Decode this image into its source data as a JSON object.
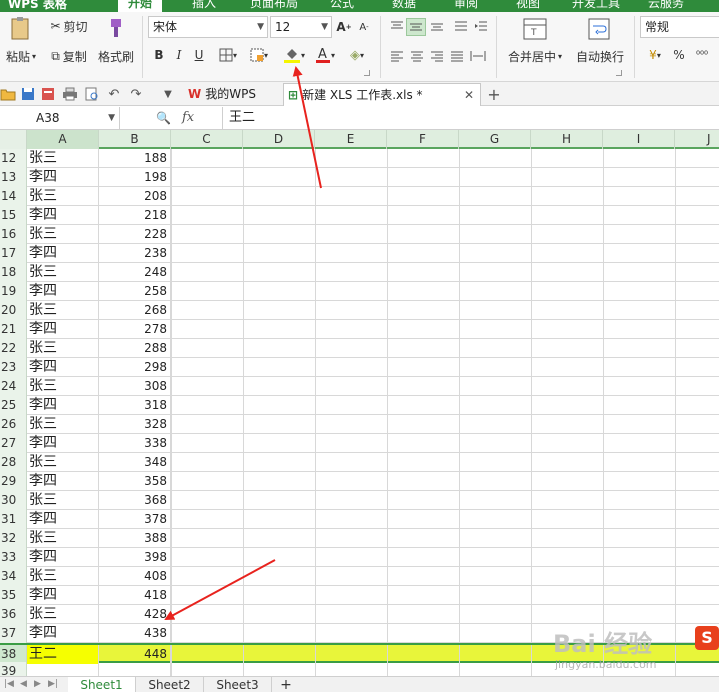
{
  "menu": {
    "app_name": "WPS 表格",
    "tabs": [
      "开始",
      "插入",
      "页面布局",
      "公式",
      "数据",
      "审阅",
      "视图",
      "开发工具",
      "云服务"
    ],
    "active_tab": "开始"
  },
  "ribbon": {
    "paste_label": "粘贴",
    "cut_label": "剪切",
    "copy_label": "复制",
    "format_painter_label": "格式刷",
    "font_name": "宋体",
    "font_size": "12",
    "bold": "B",
    "italic": "I",
    "underline": "U",
    "merge_center_label": "合并居中",
    "wrap_text_label": "自动换行",
    "number_format": "常规",
    "percent": "%",
    "fill_color": "#f5f500",
    "font_color": "#e02020"
  },
  "doc_tabs": {
    "home_tab": "我的WPS",
    "file_tab": "新建 XLS 工作表.xls *"
  },
  "formula_bar": {
    "cell_ref": "A38",
    "fx": "fx",
    "value": "王二"
  },
  "grid": {
    "columns": [
      "A",
      "B",
      "C",
      "D",
      "E",
      "F",
      "G",
      "H",
      "I",
      "J"
    ],
    "rows": [
      {
        "num": "12",
        "a": "张三",
        "b": "188"
      },
      {
        "num": "13",
        "a": "李四",
        "b": "198"
      },
      {
        "num": "14",
        "a": "张三",
        "b": "208"
      },
      {
        "num": "15",
        "a": "李四",
        "b": "218"
      },
      {
        "num": "16",
        "a": "张三",
        "b": "228"
      },
      {
        "num": "17",
        "a": "李四",
        "b": "238"
      },
      {
        "num": "18",
        "a": "张三",
        "b": "248"
      },
      {
        "num": "19",
        "a": "李四",
        "b": "258"
      },
      {
        "num": "20",
        "a": "张三",
        "b": "268"
      },
      {
        "num": "21",
        "a": "李四",
        "b": "278"
      },
      {
        "num": "22",
        "a": "张三",
        "b": "288"
      },
      {
        "num": "23",
        "a": "李四",
        "b": "298"
      },
      {
        "num": "24",
        "a": "张三",
        "b": "308"
      },
      {
        "num": "25",
        "a": "李四",
        "b": "318"
      },
      {
        "num": "26",
        "a": "张三",
        "b": "328"
      },
      {
        "num": "27",
        "a": "李四",
        "b": "338"
      },
      {
        "num": "28",
        "a": "张三",
        "b": "348"
      },
      {
        "num": "29",
        "a": "李四",
        "b": "358"
      },
      {
        "num": "30",
        "a": "张三",
        "b": "368"
      },
      {
        "num": "31",
        "a": "李四",
        "b": "378"
      },
      {
        "num": "32",
        "a": "张三",
        "b": "388"
      },
      {
        "num": "33",
        "a": "李四",
        "b": "398"
      },
      {
        "num": "34",
        "a": "张三",
        "b": "408"
      },
      {
        "num": "35",
        "a": "李四",
        "b": "418"
      },
      {
        "num": "36",
        "a": "张三",
        "b": "428"
      },
      {
        "num": "37",
        "a": "李四",
        "b": "438"
      },
      {
        "num": "38",
        "a": "王二",
        "b": "448"
      },
      {
        "num": "39",
        "a": "",
        "b": ""
      }
    ],
    "highlighted_row": "38",
    "highlight_color": "#e8f53a"
  },
  "sheets": {
    "tabs": [
      "Sheet1",
      "Sheet2",
      "Sheet3"
    ],
    "active": "Sheet1",
    "add": "+"
  },
  "watermark": {
    "text": "Bai 经验",
    "url": "jingyan.baidu.com",
    "logo": "S"
  },
  "colors": {
    "brand_green": "#2f8b3b",
    "arrow_red": "#e8231e"
  }
}
